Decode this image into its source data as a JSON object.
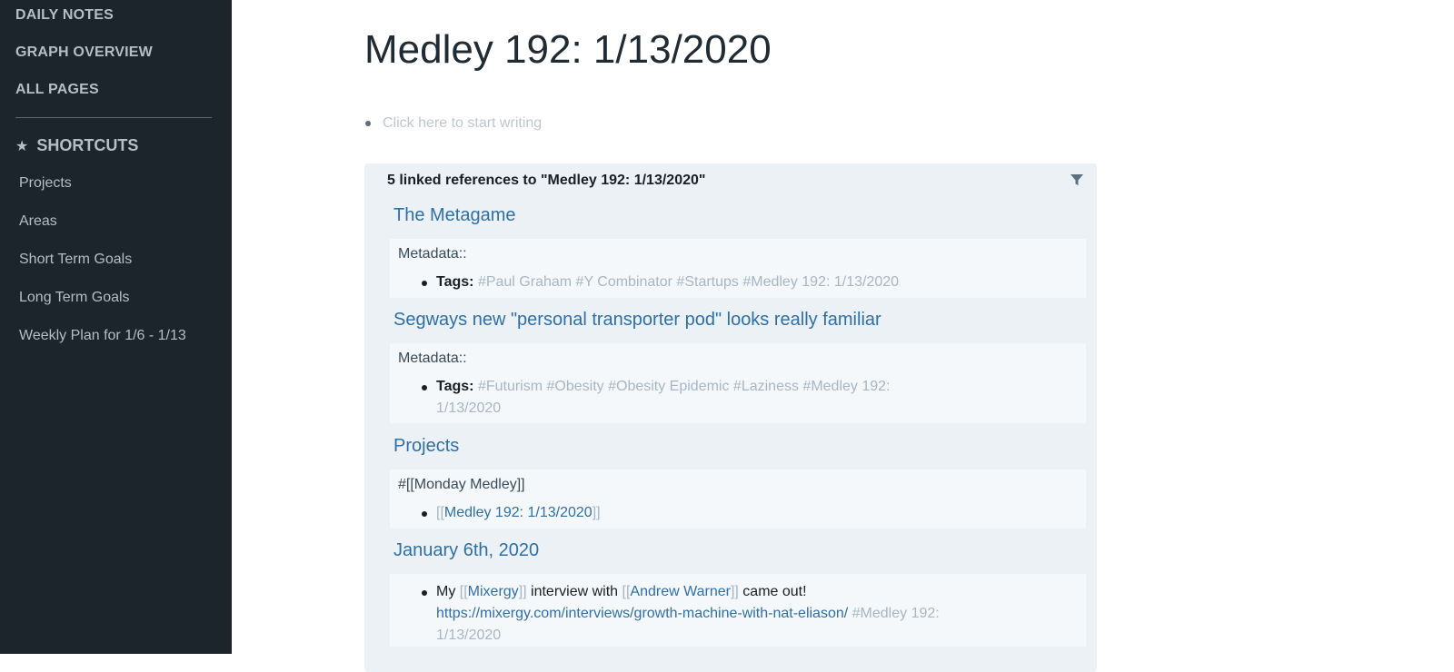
{
  "sidebar": {
    "nav": [
      "DAILY NOTES",
      "GRAPH OVERVIEW",
      "ALL PAGES"
    ],
    "shortcuts_title": "SHORTCUTS",
    "shortcuts": [
      "Projects",
      "Areas",
      "Short Term Goals",
      "Long Term Goals",
      "Weekly Plan for 1/6 - 1/13"
    ]
  },
  "page": {
    "title": "Medley 192: 1/13/2020",
    "placeholder": "Click here to start writing"
  },
  "references": {
    "header": "5 linked references to \"Medley 192: 1/13/2020\"",
    "items": [
      {
        "title": "The Metagame",
        "meta": "Metadata::",
        "tags_label": "Tags:",
        "tags": "#Paul Graham #Y Combinator #Startups #Medley 192: 1/13/2020"
      },
      {
        "title": "Segways new \"personal transporter pod\" looks really familiar",
        "meta": "Metadata::",
        "tags_label": "Tags:",
        "tags": "#Futurism #Obesity #Obesity Epidemic #Laziness #Medley 192: 1/13/2020"
      },
      {
        "title": "Projects",
        "meta": "#[[Monday Medley]]",
        "open": "[[",
        "link": "Medley 192: 1/13/2020",
        "close": "]]"
      },
      {
        "title": "January 6th, 2020",
        "t1": "My ",
        "open": "[[",
        "link1": "Mixergy",
        "close": "]]",
        "t2": " interview with ",
        "link2": "Andrew Warner",
        "t3": " came out!",
        "url": "https://mixergy.com/interviews/growth-machine-with-nat-eliason/",
        "tag": "#Medley 192: 1/13/2020"
      }
    ]
  },
  "colors": {
    "sidebar_bg": "#1c242c",
    "link": "#2f6fa8",
    "refs_bg": "#ebf1f5",
    "block_bg": "#f5f8fa",
    "tag": "#a7b6c2"
  },
  "icons": [
    "star-icon",
    "filter-icon"
  ]
}
